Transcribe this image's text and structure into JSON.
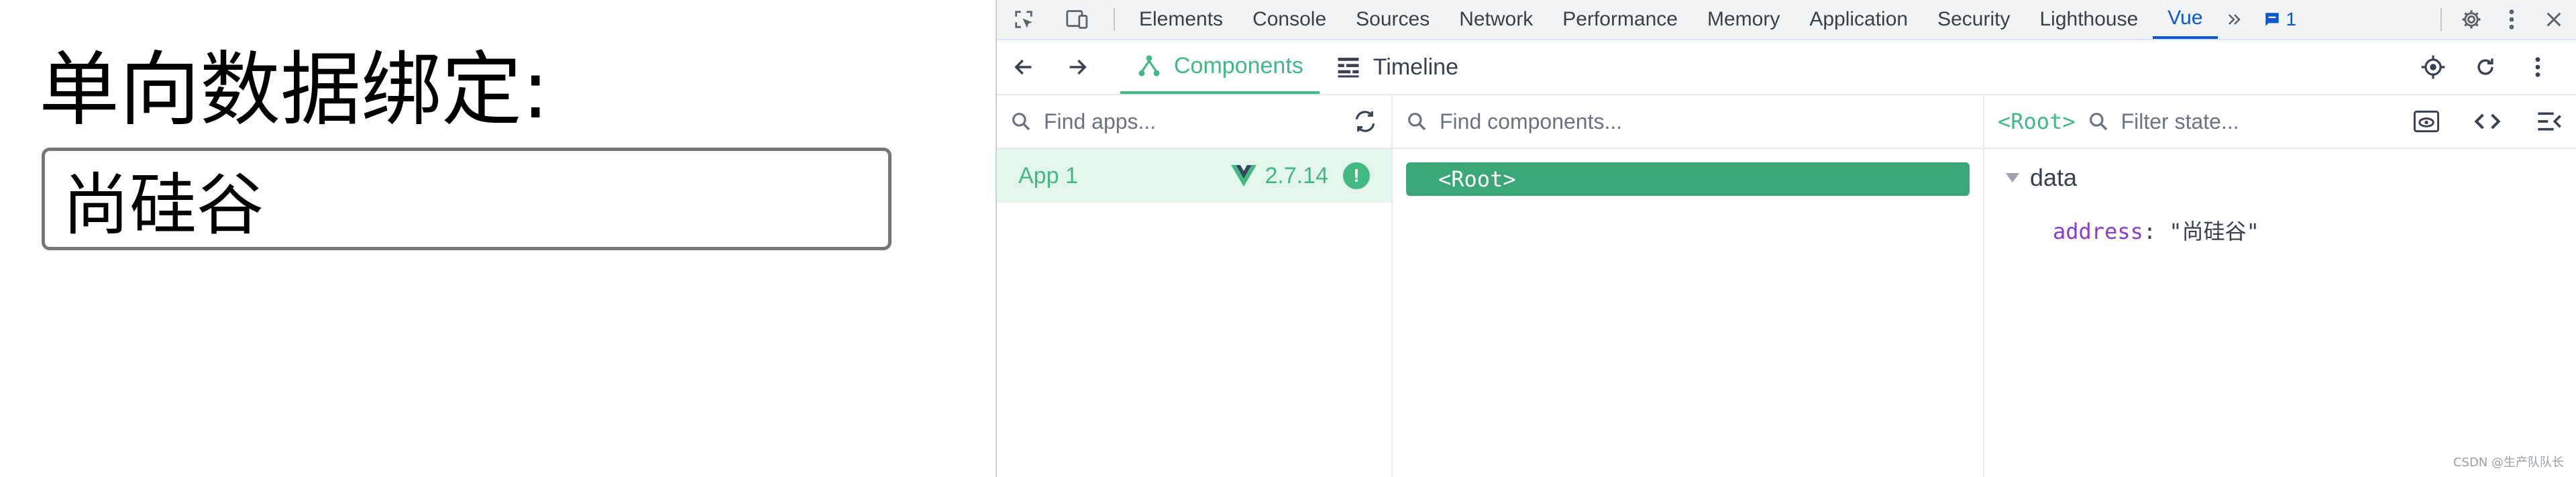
{
  "page": {
    "title": "单向数据绑定:",
    "input_value": "尚硅谷"
  },
  "devtools": {
    "tabs": [
      "Elements",
      "Console",
      "Sources",
      "Network",
      "Performance",
      "Memory",
      "Application",
      "Security",
      "Lighthouse",
      "Vue"
    ],
    "active_tab": "Vue",
    "message_count": "1",
    "vue": {
      "components_tab": "Components",
      "timeline_tab": "Timeline",
      "apps_search_placeholder": "Find apps...",
      "components_search_placeholder": "Find components...",
      "state_filter_placeholder": "Filter state...",
      "root_tag": "<Root>",
      "app": {
        "name": "App 1",
        "version": "2.7.14",
        "alert": "!"
      },
      "component_root": "<Root>",
      "state": {
        "section": "data",
        "prop_key": "address",
        "prop_value": "\"尚硅谷\""
      }
    }
  },
  "watermark": "CSDN @生产队队长",
  "colors": {
    "vue_green": "#42b883",
    "chrome_blue": "#0b57d0"
  }
}
